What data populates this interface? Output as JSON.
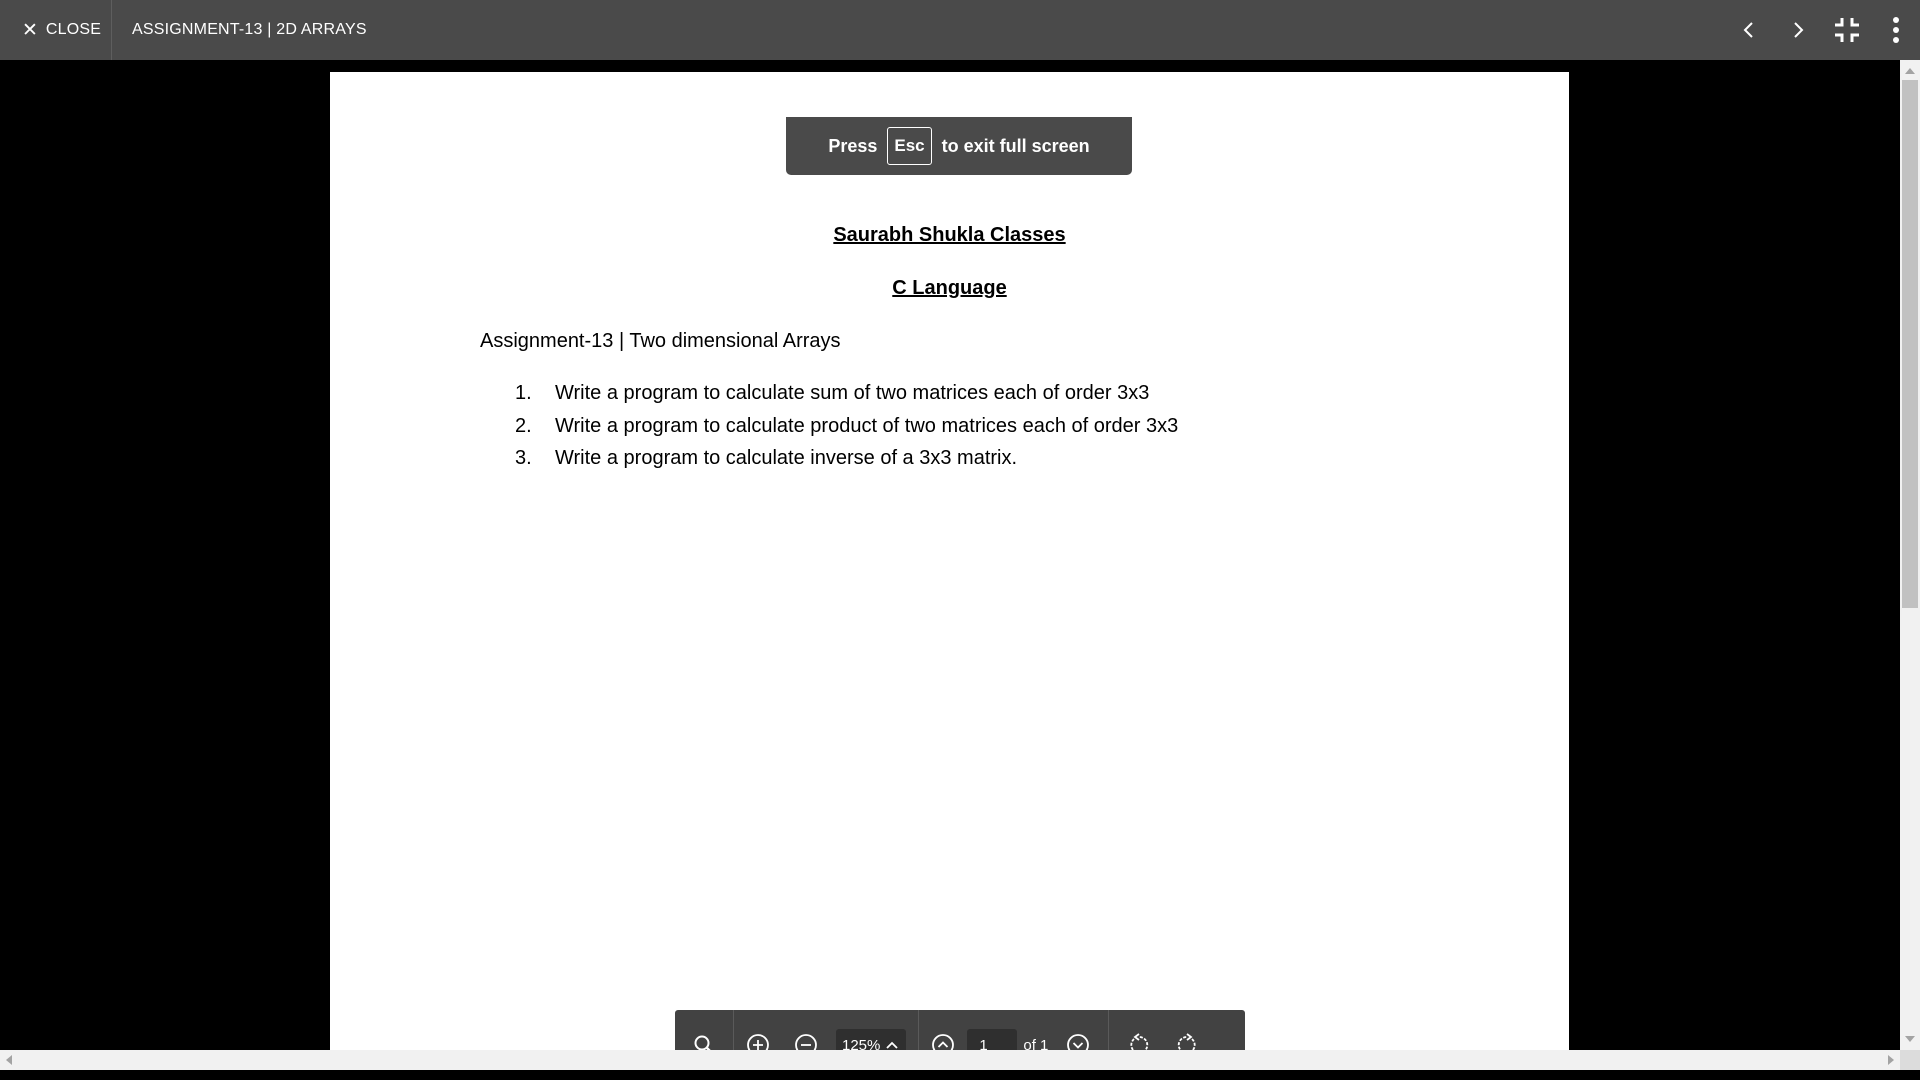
{
  "header": {
    "close_icon": "close-icon",
    "close_label": "CLOSE",
    "title": "ASSIGNMENT-13 | 2D ARRAYS",
    "actions": [
      "chevron-left-icon",
      "chevron-right-icon",
      "exit-fullscreen-icon",
      "more-vert-icon"
    ]
  },
  "toast": {
    "press": "Press",
    "key": "Esc",
    "suffix": "to exit full screen"
  },
  "document": {
    "heading1": "Saurabh Shukla Classes",
    "heading2": "C Language",
    "assignment_line": "Assignment-13 | Two dimensional Arrays",
    "tasks": [
      {
        "num": "1.",
        "text": "Write a program to calculate sum of two matrices each of order 3x3"
      },
      {
        "num": "2.",
        "text": "Write a program to calculate product of two matrices each of order 3x3"
      },
      {
        "num": "3.",
        "text": "Write a program to calculate inverse of a 3x3 matrix."
      }
    ]
  },
  "toolbar": {
    "search_icon": "search-icon",
    "zoom_in_icon": "zoom-in-icon",
    "zoom_out_icon": "zoom-out-icon",
    "zoom_value": "125%",
    "prev_page_icon": "page-up-icon",
    "page_value": "1",
    "page_of": "of 1",
    "next_page_icon": "page-down-icon",
    "rotate_left_icon": "rotate-left-icon",
    "rotate_right_icon": "rotate-right-icon"
  },
  "colors": {
    "header_bg": "#4a4a4a",
    "toolbar_bg": "#424242",
    "viewer_bg": "#000000",
    "page_bg": "#ffffff"
  }
}
